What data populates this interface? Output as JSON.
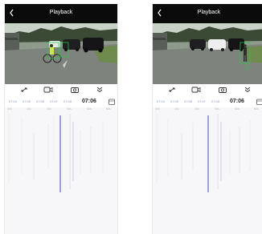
{
  "screens": [
    {
      "title": "Playback",
      "time_labels": [
        "07:04",
        "07:05",
        "07:06",
        "07:07",
        "07:08"
      ],
      "current_time": "07:06",
      "ruler_labels": [
        "30s",
        "10s",
        "20s",
        "30s",
        "40s",
        "50s"
      ]
    },
    {
      "title": "Playback",
      "time_labels": [
        "07:04",
        "07:05",
        "07:06",
        "07:07",
        "07:08"
      ],
      "current_time": "07:06",
      "ruler_labels": [
        "30s",
        "10s",
        "20s",
        "30s",
        "40s",
        "50s"
      ]
    }
  ],
  "icons": {
    "back": "chevron-left-icon",
    "fullscreen": "expand-icon",
    "record": "video-camera-icon",
    "snapshot": "camera-icon",
    "more": "chevron-double-down-icon",
    "calendar": "calendar-icon"
  },
  "colors": {
    "topbar": "#0b0b0b",
    "timeline_accent": "#4a5bd9",
    "timeline_bar": "#d8dce8",
    "detection_box": "#22cc44"
  }
}
